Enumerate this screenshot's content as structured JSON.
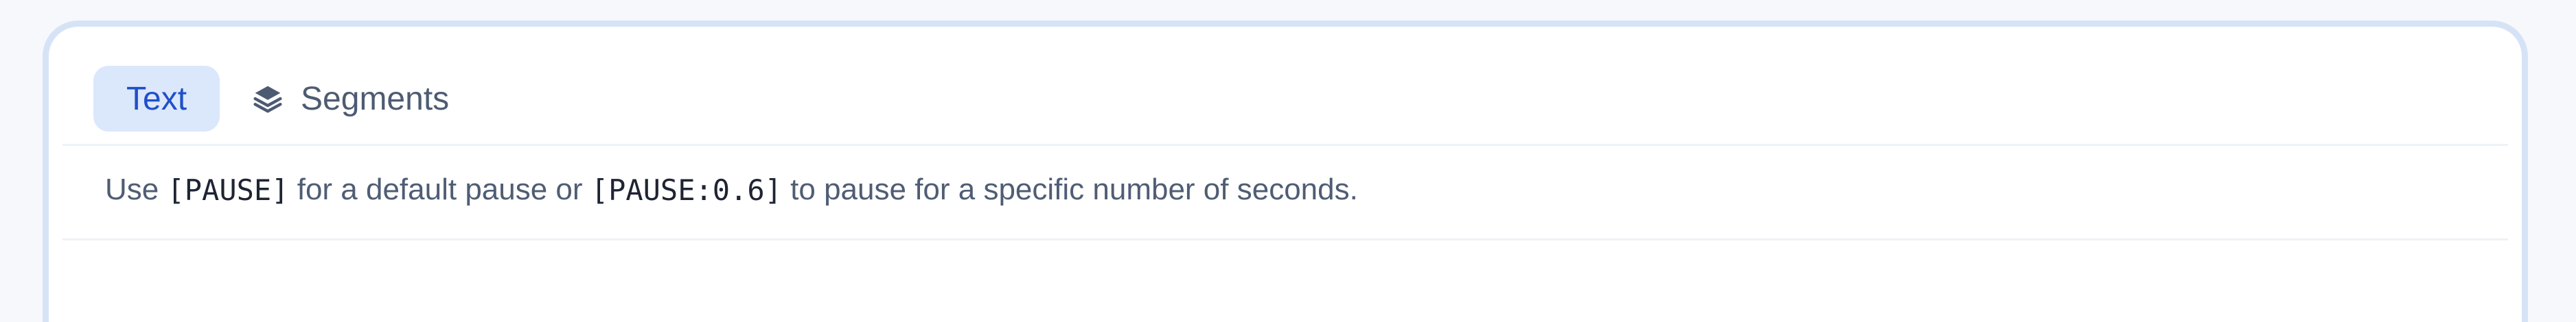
{
  "tabs": {
    "text_label": "Text",
    "segments_label": "Segments"
  },
  "hint": {
    "prefix": "Use ",
    "token_pause": "[PAUSE]",
    "middle": " for a default pause or ",
    "token_pause_seconds": "[PAUSE:0.6]",
    "suffix": " to pause for a specific number of seconds."
  },
  "icons": {
    "segments": "layers-icon"
  },
  "colors": {
    "active_tab_bg": "#dbe7fb",
    "active_tab_text": "#1f4fc9",
    "panel_border": "#d6e3f7"
  }
}
